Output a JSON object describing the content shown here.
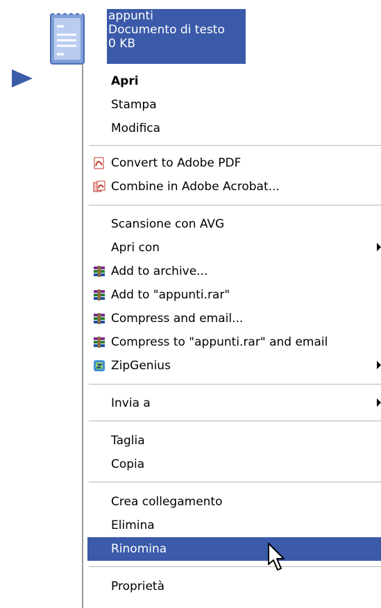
{
  "file": {
    "name": "appunti",
    "type": "Documento di testo",
    "size": "0 KB"
  },
  "menu": {
    "items": [
      {
        "label": "Apri",
        "bold": true
      },
      {
        "label": "Stampa"
      },
      {
        "label": "Modifica"
      },
      {
        "label": "Convert to Adobe PDF",
        "icon": "pdf-icon"
      },
      {
        "label": "Combine in Adobe Acrobat...",
        "icon": "acrobat-combine-icon"
      },
      {
        "label": "Scansione con AVG"
      },
      {
        "label": "Apri con",
        "submenu": true
      },
      {
        "label": "Add to archive...",
        "icon": "winrar-icon"
      },
      {
        "label": "Add to \"appunti.rar\"",
        "icon": "winrar-icon"
      },
      {
        "label": "Compress and email...",
        "icon": "winrar-icon"
      },
      {
        "label": "Compress to \"appunti.rar\" and email",
        "icon": "winrar-icon"
      },
      {
        "label": "ZipGenius",
        "icon": "zipgenius-icon",
        "submenu": true
      },
      {
        "label": "Invia a",
        "submenu": true
      },
      {
        "label": "Taglia"
      },
      {
        "label": "Copia"
      },
      {
        "label": "Crea collegamento"
      },
      {
        "label": "Elimina"
      },
      {
        "label": "Rinomina",
        "highlighted": true
      },
      {
        "label": "Proprietà"
      }
    ]
  },
  "colors": {
    "selection": "#3b5aa9",
    "pointer_arrow": "#3a5ca8"
  }
}
